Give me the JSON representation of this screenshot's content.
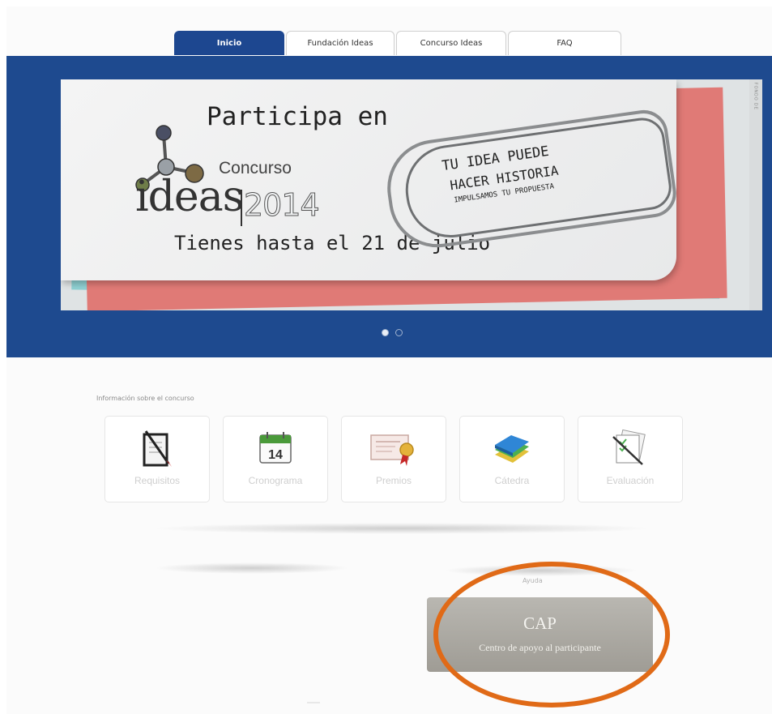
{
  "tabs": [
    {
      "label": "Inicio",
      "active": true
    },
    {
      "label": "Fundación Ideas",
      "active": false
    },
    {
      "label": "Concurso Ideas",
      "active": false
    },
    {
      "label": "FAQ",
      "active": false
    }
  ],
  "hero": {
    "participa": "Participa en",
    "concurso": "Concurso",
    "ideas": "ideas",
    "year": "2014",
    "tienes": "Tienes hasta el 21 de julio",
    "tu_idea": "TU IDEA PUEDE",
    "hacer_historia": "HACER HISTORIA",
    "impulsamos": "IMPULSAMOS TU PROPUESTA",
    "side_note": "FONDO DE",
    "slide_count": 2,
    "active_slide": 1
  },
  "info": {
    "label": "Información sobre el concurso",
    "cards": [
      {
        "label": "Requisitos",
        "icon": "checklist-icon"
      },
      {
        "label": "Cronograma",
        "icon": "calendar-icon",
        "day": "14"
      },
      {
        "label": "Premios",
        "icon": "certificate-icon"
      },
      {
        "label": "Cátedra",
        "icon": "books-icon"
      },
      {
        "label": "Evaluación",
        "icon": "documents-pen-icon"
      }
    ]
  },
  "help": {
    "ayuda_label": "Ayuda",
    "cap_title": "CAP",
    "cap_subtitle": "Centro de apoyo al participante"
  },
  "colors": {
    "hero_blue": "#1e4a8f",
    "tab_active": "#1d4790",
    "highlight_ring": "#e06a17",
    "cap_button": "#aaa7a0"
  }
}
